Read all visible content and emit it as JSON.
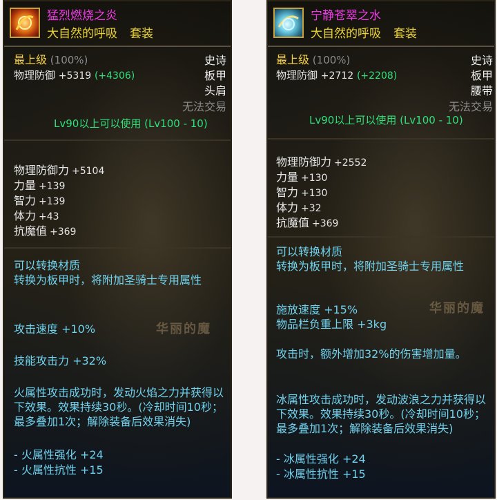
{
  "items": [
    {
      "name": "猛烈燃烧之炎",
      "set_name": "大自然的呼吸",
      "set_tag": "套装",
      "icon": "fire-orb-icon",
      "grade": "最上级",
      "grade_pct": "(100%)",
      "rarity": "史诗",
      "armor_type": "板甲",
      "slot": "头肩",
      "trade": "无法交易",
      "defense_label": "物理防御",
      "defense_value": "+5319",
      "defense_bonus": "(+4306)",
      "level_req": "Lv90以上可以使用 (Lv100 - 10)",
      "stats": [
        {
          "label": "物理防御力",
          "value": "+5104"
        },
        {
          "label": "力量",
          "value": "+139"
        },
        {
          "label": "智力",
          "value": "+139"
        },
        {
          "label": "体力",
          "value": "+43"
        },
        {
          "label": "抗魔值",
          "value": "+369"
        }
      ],
      "convert_1": "可以转换材质",
      "convert_2": "转换为板甲时，将附加圣骑士专用属性",
      "speed": "攻击速度 +10%",
      "skill": "技能攻击力 +32%",
      "effect": "火属性攻击成功时，发动火焰之力并获得以下效果。效果持续30秒。(冷却时间10秒；最多叠加1次；解除装备后效果消失)",
      "effect_line_1": "- 火属性强化 +24",
      "effect_line_2": "- 火属性抗性 +15",
      "watermark": "华丽的魔"
    },
    {
      "name": "宁静苍翠之水",
      "set_name": "大自然的呼吸",
      "set_tag": "套装",
      "icon": "water-orb-icon",
      "grade": "最上级",
      "grade_pct": "(100%)",
      "rarity": "史诗",
      "armor_type": "板甲",
      "slot": "腰带",
      "trade": "无法交易",
      "defense_label": "物理防御",
      "defense_value": "+2712",
      "defense_bonus": "(+2208)",
      "level_req": "Lv90以上可以使用 (Lv100 - 10)",
      "stats": [
        {
          "label": "物理防御力",
          "value": "+2552"
        },
        {
          "label": "力量",
          "value": "+130"
        },
        {
          "label": "智力",
          "value": "+130"
        },
        {
          "label": "体力",
          "value": "+32"
        },
        {
          "label": "抗魔值",
          "value": "+369"
        }
      ],
      "convert_1": "可以转换材质",
      "convert_2": "转换为板甲时，将附加圣骑士专用属性",
      "speed": "施放速度 +15%",
      "weight": "物品栏负重上限 +3kg",
      "extra": "攻击时，额外增加32%的伤害增加量。",
      "effect": "冰属性攻击成功时，发动波浪之力并获得以下效果。效果持续30秒。(冷却时间10秒；最多叠加1次；解除装备后效果消失)",
      "effect_line_1": "- 冰属性强化 +24",
      "effect_line_2": "- 冰属性抗性 +15",
      "watermark": "华丽的魔"
    }
  ],
  "colors": {
    "name": "#ef3de6",
    "set": "#ecd432",
    "desc": "#6fd2ee",
    "level": "#30e07a",
    "rarity": "#f0c52a"
  }
}
